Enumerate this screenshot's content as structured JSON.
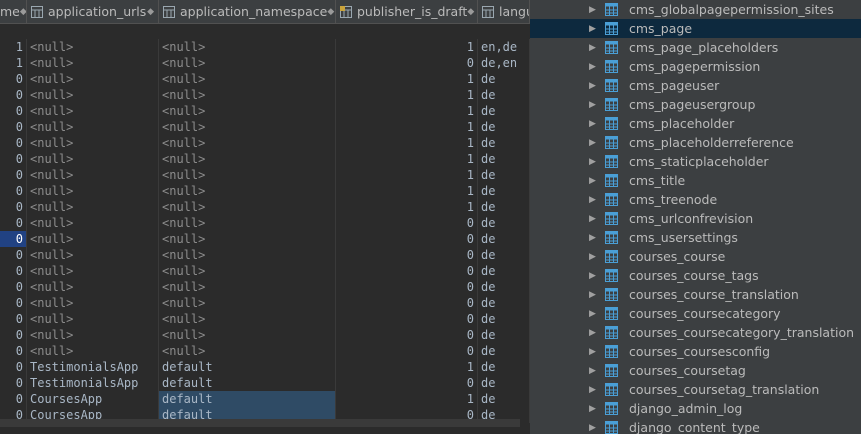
{
  "columns": [
    {
      "label": "me",
      "icon": "none"
    },
    {
      "label": "application_urls",
      "icon": "column-icon"
    },
    {
      "label": "application_namespace",
      "icon": "column-icon"
    },
    {
      "label": "publisher_is_draft",
      "icon": "column-key-icon"
    },
    {
      "label": "langu",
      "icon": "column-icon"
    }
  ],
  "sort_glyph": "◆",
  "rows": [
    {
      "c0": "1",
      "c1": "<null>",
      "c2": "<null>",
      "c3": "1",
      "c4": "en,de"
    },
    {
      "c0": "1",
      "c1": "<null>",
      "c2": "<null>",
      "c3": "0",
      "c4": "de,en"
    },
    {
      "c0": "0",
      "c1": "<null>",
      "c2": "<null>",
      "c3": "1",
      "c4": "de"
    },
    {
      "c0": "0",
      "c1": "<null>",
      "c2": "<null>",
      "c3": "1",
      "c4": "de"
    },
    {
      "c0": "0",
      "c1": "<null>",
      "c2": "<null>",
      "c3": "1",
      "c4": "de"
    },
    {
      "c0": "0",
      "c1": "<null>",
      "c2": "<null>",
      "c3": "1",
      "c4": "de"
    },
    {
      "c0": "0",
      "c1": "<null>",
      "c2": "<null>",
      "c3": "1",
      "c4": "de"
    },
    {
      "c0": "0",
      "c1": "<null>",
      "c2": "<null>",
      "c3": "1",
      "c4": "de"
    },
    {
      "c0": "0",
      "c1": "<null>",
      "c2": "<null>",
      "c3": "1",
      "c4": "de"
    },
    {
      "c0": "0",
      "c1": "<null>",
      "c2": "<null>",
      "c3": "1",
      "c4": "de"
    },
    {
      "c0": "0",
      "c1": "<null>",
      "c2": "<null>",
      "c3": "1",
      "c4": "de"
    },
    {
      "c0": "0",
      "c1": "<null>",
      "c2": "<null>",
      "c3": "0",
      "c4": "de"
    },
    {
      "c0": "0",
      "c1": "<null>",
      "c2": "<null>",
      "c3": "0",
      "c4": "de"
    },
    {
      "c0": "0",
      "c1": "<null>",
      "c2": "<null>",
      "c3": "0",
      "c4": "de"
    },
    {
      "c0": "0",
      "c1": "<null>",
      "c2": "<null>",
      "c3": "0",
      "c4": "de"
    },
    {
      "c0": "0",
      "c1": "<null>",
      "c2": "<null>",
      "c3": "0",
      "c4": "de"
    },
    {
      "c0": "0",
      "c1": "<null>",
      "c2": "<null>",
      "c3": "0",
      "c4": "de"
    },
    {
      "c0": "0",
      "c1": "<null>",
      "c2": "<null>",
      "c3": "0",
      "c4": "de"
    },
    {
      "c0": "0",
      "c1": "<null>",
      "c2": "<null>",
      "c3": "0",
      "c4": "de"
    },
    {
      "c0": "0",
      "c1": "<null>",
      "c2": "<null>",
      "c3": "0",
      "c4": "de"
    },
    {
      "c0": "0",
      "c1": "TestimonialsApp",
      "c2": "default",
      "c3": "1",
      "c4": "de"
    },
    {
      "c0": "0",
      "c1": "TestimonialsApp",
      "c2": "default",
      "c3": "0",
      "c4": "de"
    },
    {
      "c0": "0",
      "c1": "CoursesApp",
      "c2": "default",
      "c3": "1",
      "c4": "de"
    },
    {
      "c0": "0",
      "c1": "CoursesApp",
      "c2": "default",
      "c3": "0",
      "c4": "de"
    }
  ],
  "tree": [
    {
      "label": "cms_globalpagepermission_sites"
    },
    {
      "label": "cms_page",
      "selected": true
    },
    {
      "label": "cms_page_placeholders"
    },
    {
      "label": "cms_pagepermission"
    },
    {
      "label": "cms_pageuser"
    },
    {
      "label": "cms_pageusergroup"
    },
    {
      "label": "cms_placeholder"
    },
    {
      "label": "cms_placeholderreference"
    },
    {
      "label": "cms_staticplaceholder"
    },
    {
      "label": "cms_title"
    },
    {
      "label": "cms_treenode"
    },
    {
      "label": "cms_urlconfrevision"
    },
    {
      "label": "cms_usersettings"
    },
    {
      "label": "courses_course"
    },
    {
      "label": "courses_course_tags"
    },
    {
      "label": "courses_course_translation"
    },
    {
      "label": "courses_coursecategory"
    },
    {
      "label": "courses_coursecategory_translation"
    },
    {
      "label": "courses_coursesconfig"
    },
    {
      "label": "courses_coursetag"
    },
    {
      "label": "courses_coursetag_translation"
    },
    {
      "label": "django_admin_log"
    },
    {
      "label": "django_content_type"
    }
  ],
  "tree_arrow": "▶",
  "colors": {
    "table_icon": "#4a9fd6",
    "selection": "#214283",
    "cell_selection": "#2f4b65"
  }
}
